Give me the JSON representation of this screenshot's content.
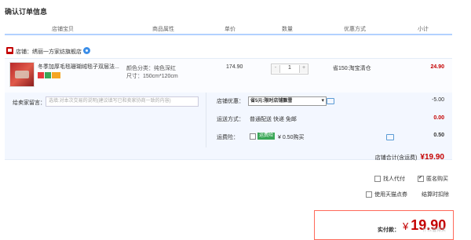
{
  "page_title": "确认订单信息",
  "columns": [
    "店铺宝贝",
    "商品属性",
    "单价",
    "数量",
    "优惠方式",
    "小计"
  ],
  "shop": {
    "label": "店铺：绣丽一方家纺旗舰店"
  },
  "item": {
    "name": "冬季加厚毛毯珊瑚绒毯子双层法...",
    "attr_color": "颜色分类：纯色深红",
    "attr_size": "尺寸：150cm*120cm",
    "price": "174.90",
    "qty_minus": "-",
    "qty": "1",
    "qty_plus": "+",
    "promo": "省150:淘宝清仓",
    "subtotal": "24.90"
  },
  "options": {
    "message_label": "给卖家留言：",
    "message_placeholder": "选填:对本次交易的说明(建议填写已和卖家协商一致的内容)",
    "discount_label": "店铺优惠：",
    "discount_selected": "省5元:限时店铺飘雪",
    "discount_value": "-5.00",
    "shipping_label": "运送方式：",
    "shipping_text": "普通配送 快递 免邮",
    "shipping_value": "0.00",
    "insurance_label": "运费险：",
    "insurance_tag": "运费险",
    "insurance_text": "¥ 0.50购买",
    "insurance_value": "0.50",
    "shop_total_label": "店铺合计(含运费)",
    "shop_total_value": "¥19.90"
  },
  "extras": {
    "proxy_pay": "找人代付",
    "anonymous": "匿名购买",
    "tmall_points": "使用天猫点券",
    "tmall_points_link": "结算时扣除"
  },
  "final": {
    "label": "实付款：",
    "currency": "¥",
    "amount": "19.90"
  },
  "watermark": "什么值得买",
  "colors": {
    "accent": "#c40000",
    "header_line": "#b2d1ff",
    "panel": "#f3f7ff"
  }
}
